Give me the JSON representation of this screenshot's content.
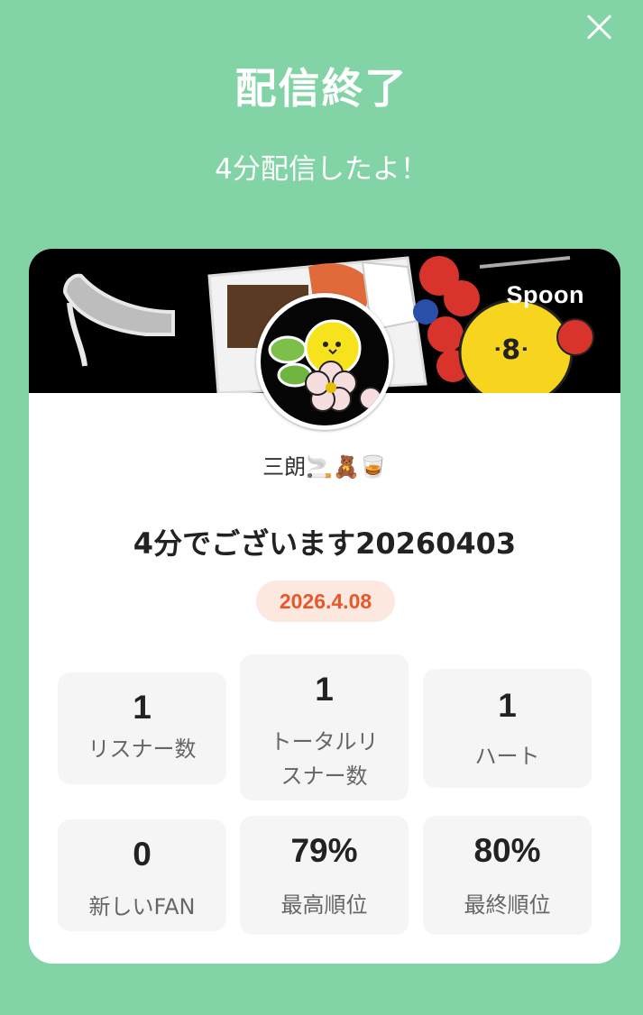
{
  "header": {
    "title": "配信終了",
    "subtitle": "4分配信したよ！"
  },
  "card": {
    "brand": "Spoon",
    "username": "三朗🚬🧸🥃",
    "live_title": "4分でございます20260403",
    "date": "2026.4.08"
  },
  "stats": [
    {
      "value": "1",
      "label": "リスナー数"
    },
    {
      "value": "1",
      "label": "トータルリスナー数",
      "label_line1": "トータルリ",
      "label_line2": "スナー数"
    },
    {
      "value": "1",
      "label": "ハート"
    },
    {
      "value": "0",
      "label": "新しいFAN"
    },
    {
      "value": "79%",
      "label": "最高順位"
    },
    {
      "value": "80%",
      "label": "最終順位"
    }
  ],
  "colors": {
    "background": "#82d3a6",
    "card": "#ffffff",
    "date_badge_bg": "#fde8df",
    "date_badge_text": "#e8572a",
    "stat_bg": "#f5f5f5"
  },
  "icons": {
    "close": "close-icon",
    "avatar": "avatar"
  }
}
